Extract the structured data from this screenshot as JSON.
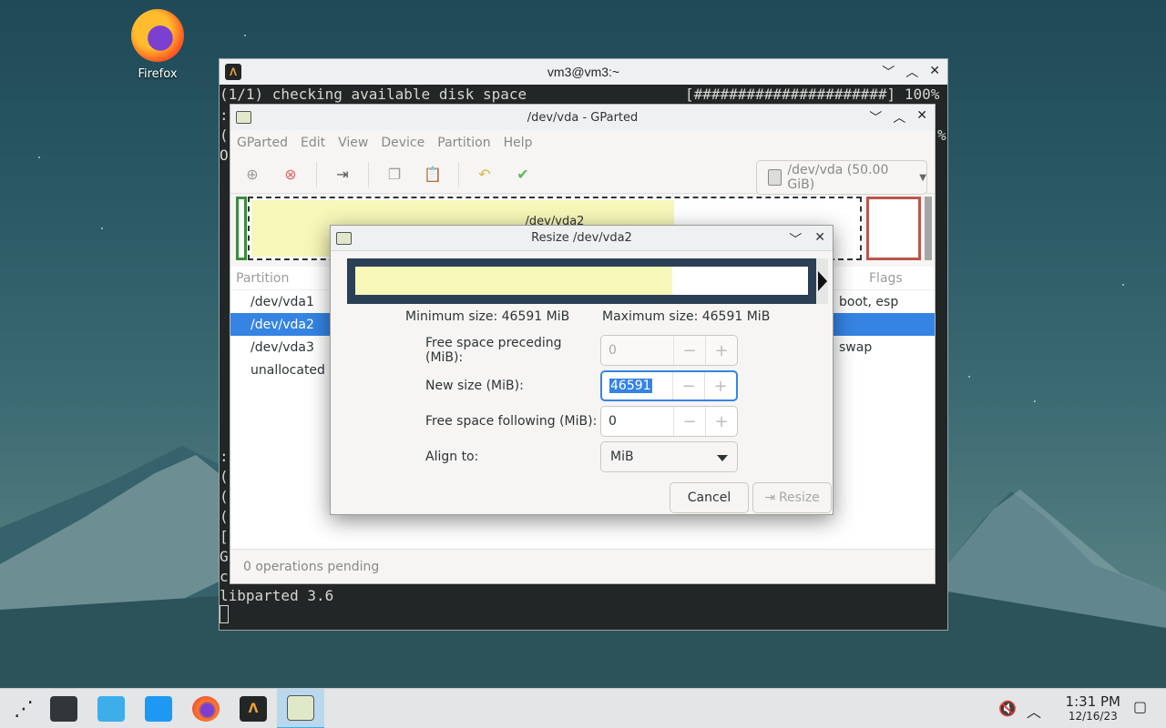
{
  "desktop": {
    "icon_label": "Firefox"
  },
  "terminal": {
    "title": "vm3@vm3:~",
    "line1_left": "(1/1) checking available disk space",
    "line1_right": "[######################] 100%",
    "frag_colon1": ":",
    "frag_paren1": "(",
    "frag_o": "O",
    "frag_pct": "%",
    "frag_colon2": ":",
    "frag_paren2": "(",
    "frag_paren3": "(",
    "frag_paren4": "(",
    "frag_bracket": "[",
    "frag_g": "G",
    "frag_c": "c",
    "last_line": "libparted 3.6"
  },
  "gparted": {
    "title": "/dev/vda - GParted",
    "menu": [
      "GParted",
      "Edit",
      "View",
      "Device",
      "Partition",
      "Help"
    ],
    "device_selector": "/dev/vda (50.00 GiB)",
    "map_label": "/dev/vda2",
    "columns": {
      "partition": "Partition",
      "flags": "Flags"
    },
    "rows": [
      {
        "name": "/dev/vda1",
        "flags": "boot, esp"
      },
      {
        "name": "/dev/vda2",
        "flags": ""
      },
      {
        "name": "/dev/vda3",
        "flags": "swap"
      },
      {
        "name": "unallocated",
        "flags": ""
      }
    ],
    "status": "0 operations pending"
  },
  "dialog": {
    "title": "Resize /dev/vda2",
    "min_size": "Minimum size: 46591 MiB",
    "max_size": "Maximum size: 46591 MiB",
    "used_fraction": 0.7,
    "fields": {
      "preceding_label": "Free space preceding (MiB):",
      "preceding_value": "0",
      "newsize_label": "New size (MiB):",
      "newsize_value": "46591",
      "following_label": "Free space following (MiB):",
      "following_value": "0",
      "align_label": "Align to:",
      "align_value": "MiB"
    },
    "cancel_label": "Cancel",
    "resize_label": "Resize"
  },
  "taskbar": {
    "time": "1:31 PM",
    "date": "12/16/23",
    "accent": "#3daee9"
  }
}
